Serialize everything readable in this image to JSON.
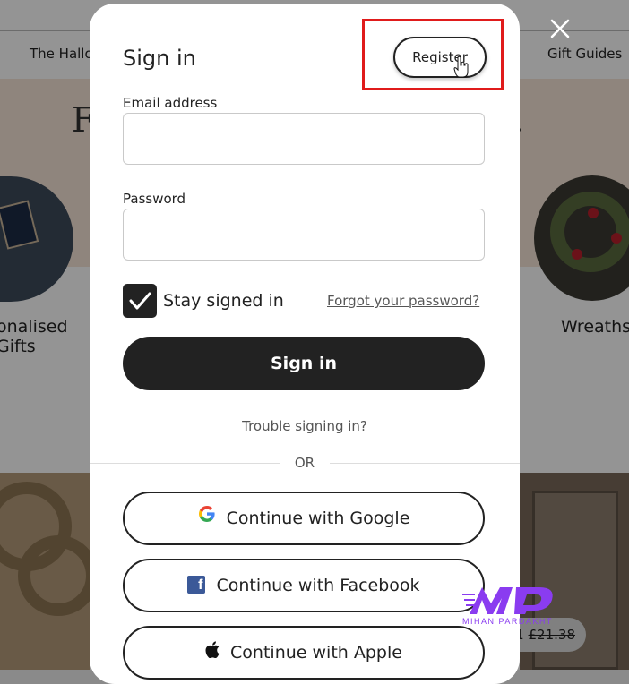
{
  "background": {
    "nav_left": "The Hallo",
    "nav_right": "Gift Guides",
    "hero_title_left": "F",
    "hero_title_right": "n.",
    "label_left_line1": "onalised",
    "label_left_line2": "Gifts",
    "label_right": "Wreaths",
    "price_current": "1",
    "price_old": "£21.38",
    "close_icon": "close-icon"
  },
  "modal": {
    "title": "Sign in",
    "register_label": "Register",
    "email_label": "Email address",
    "email_value": "",
    "password_label": "Password",
    "password_value": "",
    "stay_signed_in": "Stay signed in",
    "stay_signed_in_checked": true,
    "forgot_password": "Forgot your password?",
    "sign_in_button": "Sign in",
    "trouble": "Trouble signing in?",
    "or": "OR",
    "google": "Continue with Google",
    "facebook": "Continue with Facebook",
    "apple": "Continue with Apple"
  },
  "watermark": {
    "text": "MIHAN PARDAKHT",
    "color": "#8a3cf0"
  },
  "colors": {
    "primary_dark": "#222222",
    "highlight": "#e01b1b",
    "facebook_blue": "#3b5998"
  }
}
